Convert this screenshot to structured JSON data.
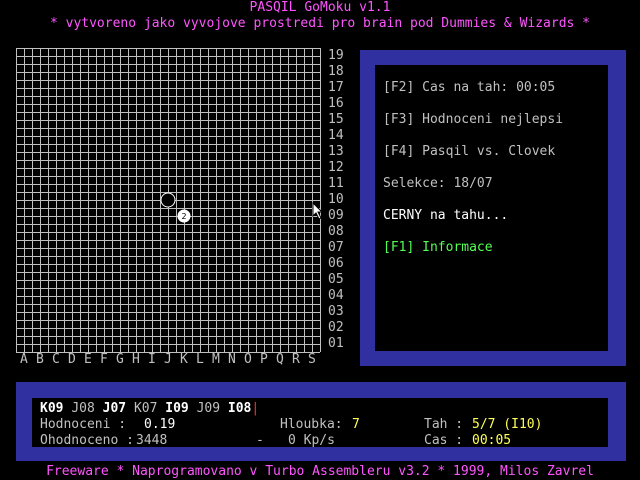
{
  "header": {
    "title": "PASQIL GoMoku v1.1",
    "subtitle": "* vytvoreno jako vyvojove prostredi pro brain pod Dummies & Wizards *"
  },
  "board": {
    "files": [
      "A",
      "B",
      "C",
      "D",
      "E",
      "F",
      "G",
      "H",
      "I",
      "J",
      "K",
      "L",
      "M",
      "N",
      "O",
      "P",
      "Q",
      "R",
      "S"
    ],
    "ranks": [
      "19",
      "18",
      "17",
      "16",
      "15",
      "14",
      "13",
      "12",
      "11",
      "10",
      "09",
      "08",
      "07",
      "06",
      "05",
      "04",
      "03",
      "02",
      "01"
    ],
    "stones": [
      {
        "col": "J",
        "row": "10",
        "color": "white",
        "label": ""
      },
      {
        "col": "K",
        "row": "09",
        "color": "white",
        "label": "2"
      }
    ]
  },
  "side_panel": {
    "f2_key": "[F2]",
    "f2_label": "Cas na tah:",
    "f2_value": "00:05",
    "f3_key": "[F3]",
    "f3_label": "Hodnoceni nejlepsi",
    "f4_key": "[F4]",
    "f4_label": "Pasqil vs. Clovek",
    "selection_label": "Selekce:",
    "selection_value": "18/07",
    "turn_text": "CERNY na tahu...",
    "f1_key": "[F1]",
    "f1_label": "Informace"
  },
  "status": {
    "moves": [
      {
        "text": "K09",
        "bright": true
      },
      {
        "text": "J08",
        "bright": false
      },
      {
        "text": "J07",
        "bright": true
      },
      {
        "text": "K07",
        "bright": false
      },
      {
        "text": "I09",
        "bright": true
      },
      {
        "text": "J09",
        "bright": false
      },
      {
        "text": "I08",
        "bright": true
      }
    ],
    "eval_label": "Hodnoceni :",
    "eval_value": "0.19",
    "depth_label": "Hloubka:",
    "depth_value": "7",
    "move_label": "Tah :",
    "move_value": "5/7 (I10)",
    "evaluated_label": "Ohodnoceno :",
    "evaluated_value": "3448",
    "dash": "-",
    "speed_value": "0 Kp/s",
    "time_label": "Cas :",
    "time_value": "00:05"
  },
  "footer": {
    "text": "Freeware * Naprogramovano v Turbo Assembleru v3.2 * 1999, Milos Zavrel"
  },
  "colors": {
    "panel": "#3030a0",
    "magenta": "#ff55ff",
    "green": "#55ff55",
    "yellow": "#ffff55",
    "grid": "#c0c0c0"
  }
}
